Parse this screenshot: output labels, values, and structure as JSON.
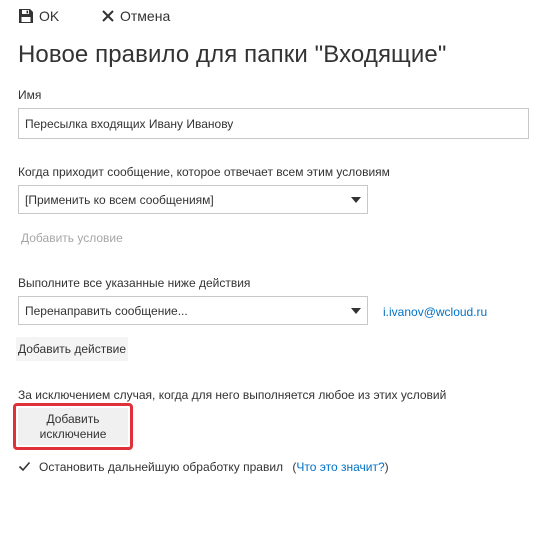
{
  "toolbar": {
    "ok_label": "OK",
    "cancel_label": "Отмена"
  },
  "page_title": "Новое правило для папки \"Входящие\"",
  "name_field": {
    "label": "Имя",
    "value": "Пересылка входящих Ивану Иванову"
  },
  "conditions": {
    "label": "Когда приходит сообщение, которое отвечает всем этим условиям",
    "selected": "[Применить ко всем сообщениям]",
    "add_label": "Добавить условие"
  },
  "actions": {
    "label": "Выполните все указанные ниже действия",
    "selected": "Перенаправить сообщение...",
    "recipient": "i.ivanov@wcloud.ru",
    "add_label": "Добавить действие"
  },
  "exceptions": {
    "label": "За исключением случая, когда для него выполняется любое из этих условий",
    "add_label_line1": "Добавить",
    "add_label_line2": "исключение"
  },
  "stop_processing": {
    "checked": true,
    "label": "Остановить дальнейшую обработку правил",
    "help_open": "(",
    "help_link": "Что это значит?",
    "help_close": ")"
  },
  "colors": {
    "accent": "#0072c6",
    "highlight": "#e0313a",
    "disabled": "#a6a6a6"
  }
}
